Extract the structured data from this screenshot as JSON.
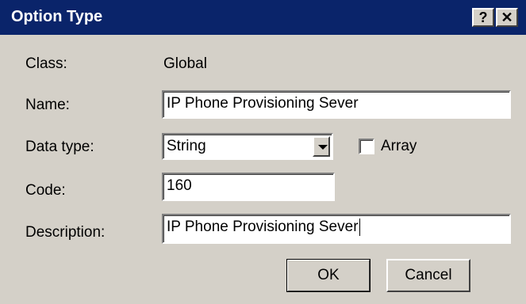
{
  "window": {
    "title": "Option Type",
    "help_icon": "question-mark-icon",
    "close_icon": "close-x-icon",
    "help_glyph": "?",
    "close_glyph": "✕"
  },
  "form": {
    "class_label": "Class:",
    "class_value": "Global",
    "name_label": "Name:",
    "name_value": "IP Phone Provisioning Sever",
    "data_type_label": "Data type:",
    "data_type_value": "String",
    "array_label": "Array",
    "array_checked": false,
    "code_label": "Code:",
    "code_value": "160",
    "description_label": "Description:",
    "description_value": "IP Phone Provisioning Sever"
  },
  "buttons": {
    "ok_label": "OK",
    "cancel_label": "Cancel"
  }
}
